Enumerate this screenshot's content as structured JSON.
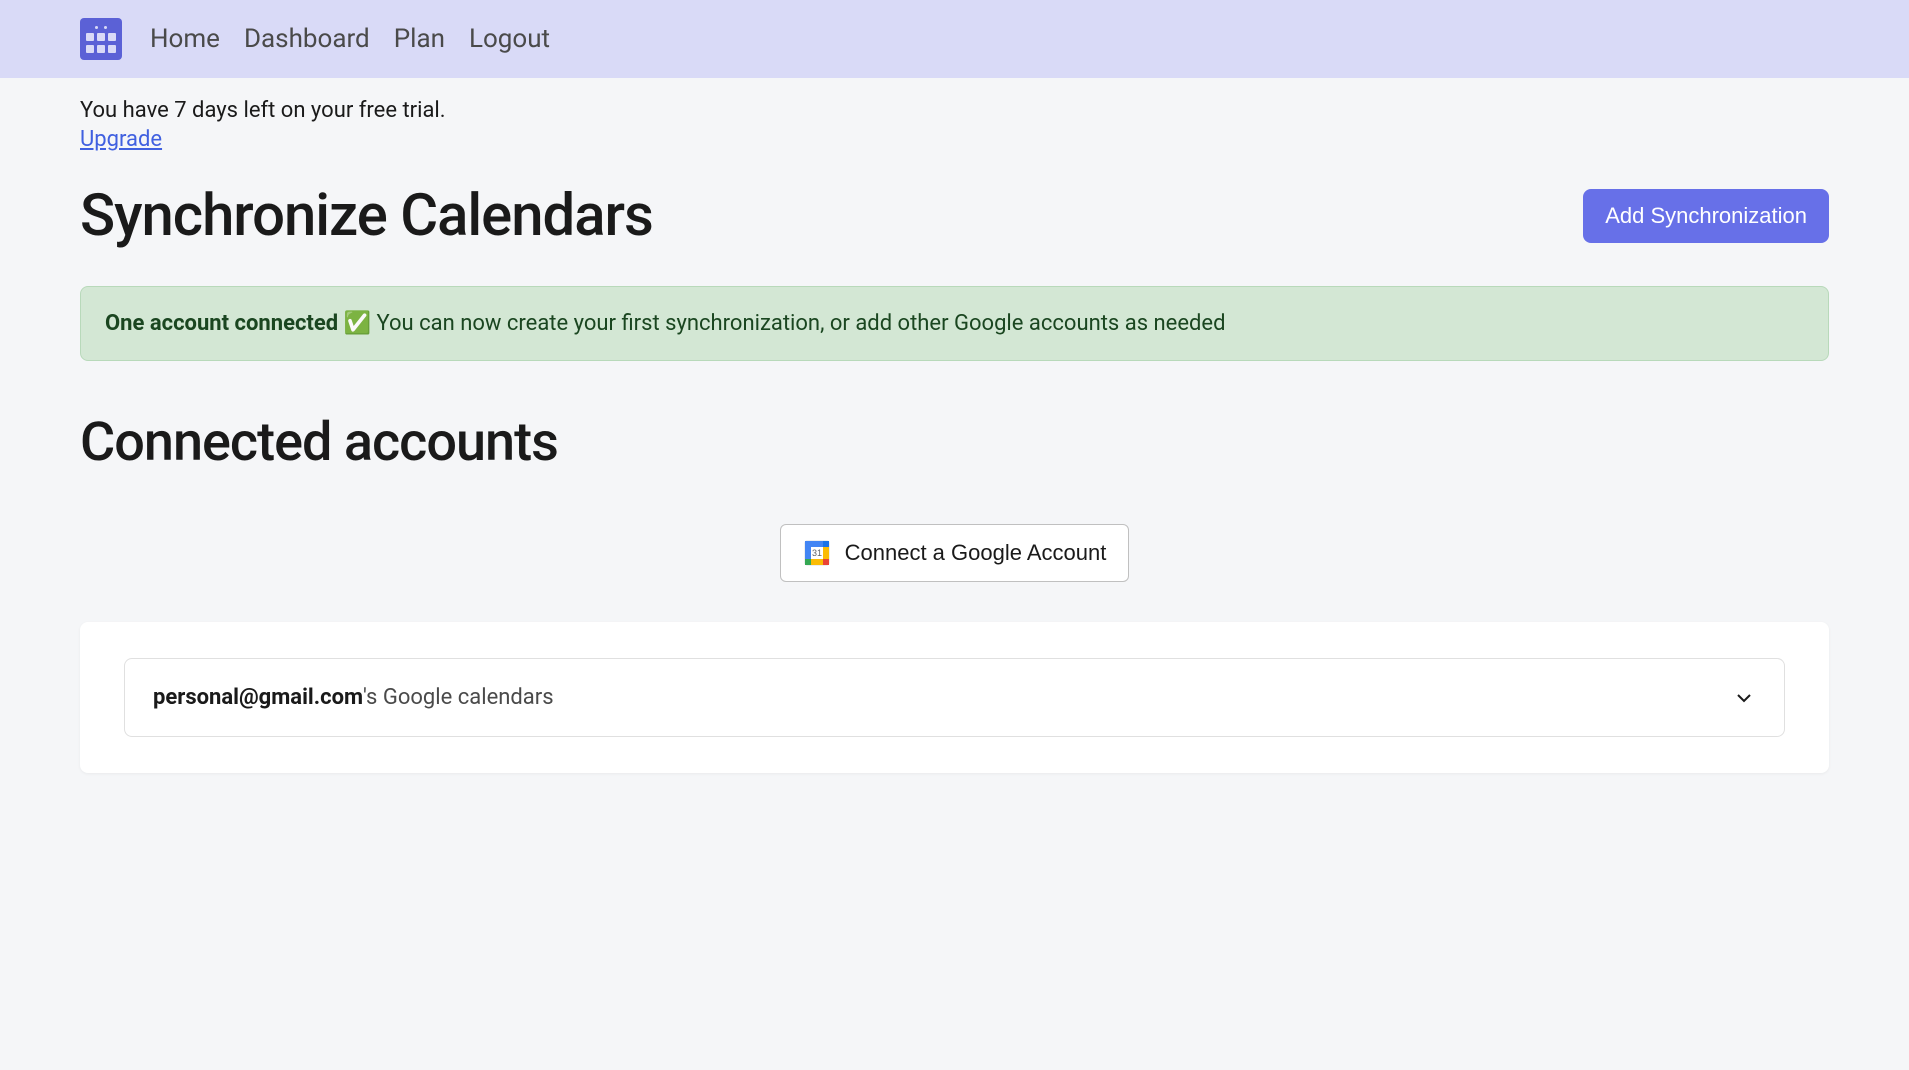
{
  "nav": {
    "links": [
      "Home",
      "Dashboard",
      "Plan",
      "Logout"
    ]
  },
  "trial": {
    "notice": "You have 7 days left on your free trial.",
    "upgrade": "Upgrade"
  },
  "page": {
    "title": "Synchronize Calendars",
    "add_sync_btn": "Add Synchronization"
  },
  "banner": {
    "bold": "One account connected",
    "emoji": "✅",
    "text": "You can now create your first synchronization, or add other Google accounts as needed"
  },
  "connected": {
    "title": "Connected accounts",
    "connect_btn": "Connect a Google Account"
  },
  "account": {
    "email": "personal@gmail.com",
    "suffix": "'s Google calendars"
  }
}
